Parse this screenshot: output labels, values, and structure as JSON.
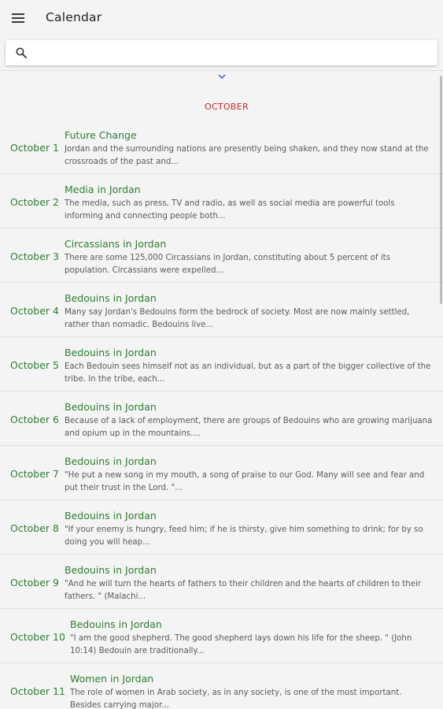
{
  "app_bar": {
    "title": "Calendar",
    "menu_icon": "hamburger-menu-icon"
  },
  "search": {
    "icon": "search-icon",
    "value": "",
    "placeholder": ""
  },
  "colors": {
    "accent_green": "#2e7d32",
    "month_red": "#c62828",
    "background": "#f4f4f4"
  },
  "month": "OCTOBER",
  "entries": [
    {
      "date": "October 1",
      "title": "Future Change",
      "desc": "Jordan and the surrounding nations are presently being shaken, and they now stand at the crossroads of the past and..."
    },
    {
      "date": "October 2",
      "title": "Media in Jordan",
      "desc": "The media, such as press, TV and radio, as well as social media are powerful tools informing and connecting people both..."
    },
    {
      "date": "October 3",
      "title": "Circassians in Jordan",
      "desc": "There are some 125,000 Circassians in Jordan, constituting about 5 percent of its population. Circassians were expelled..."
    },
    {
      "date": "October 4",
      "title": "Bedouins in Jordan",
      "desc": "Many say Jordan's Bedouins form the bedrock of society. Most are now mainly settled, rather than nomadic. Bedouins live..."
    },
    {
      "date": "October 5",
      "title": "Bedouins in Jordan",
      "desc": "Each Bedouin sees himself not as an individual, but as a part of the bigger collective of the tribe. In the tribe, each..."
    },
    {
      "date": "October 6",
      "title": "Bedouins in Jordan",
      "desc": "Because of a lack of employment, there are groups of Bedouins who are growing marijuana and opium up in the mountains...."
    },
    {
      "date": "October 7",
      "title": "Bedouins in Jordan",
      "desc": "\"He put a new song in my mouth, a song of praise to our God. Many will see and fear and put their trust in the Lord. \"..."
    },
    {
      "date": "October 8",
      "title": "Bedouins in Jordan",
      "desc": "\"If your enemy is hungry, feed him; if he is thirsty, give him something to drink; for by so doing you will heap..."
    },
    {
      "date": "October 9",
      "title": "Bedouins in Jordan",
      "desc": "\"And he will turn the hearts of fathers to their children and the hearts of children to their fathers. \" (Malachi..."
    },
    {
      "date": "October 10",
      "title": "Bedouins in Jordan",
      "desc": "\"I am the good shepherd. The good shepherd lays down his life for the sheep. \" (John 10:14) Bedouin are traditionally..."
    },
    {
      "date": "October 11",
      "title": "Women in Jordan",
      "desc": "The role of women in Arab society, as in any society, is one of the most important. Besides carrying major..."
    }
  ]
}
